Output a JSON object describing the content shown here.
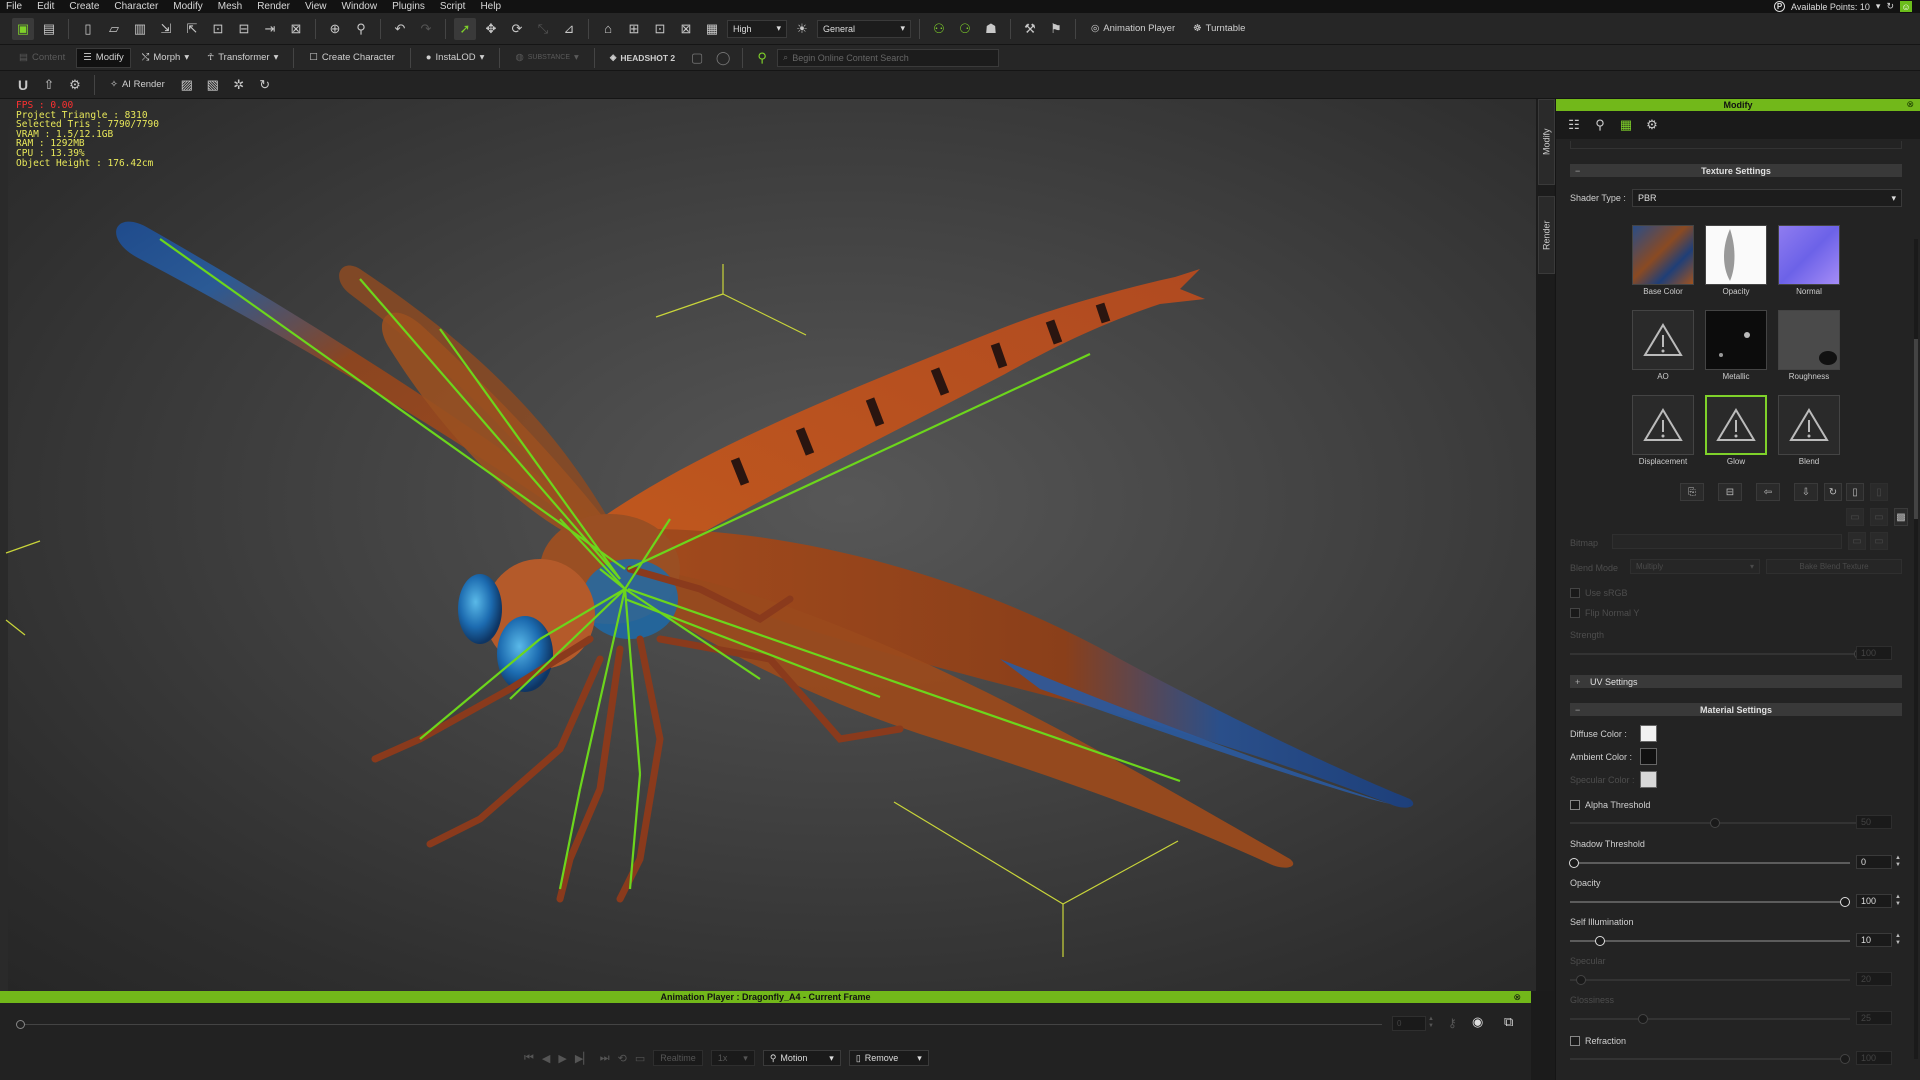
{
  "menu": [
    "File",
    "Edit",
    "Create",
    "Character",
    "Modify",
    "Mesh",
    "Render",
    "View",
    "Window",
    "Plugins",
    "Script",
    "Help"
  ],
  "available_points": "Available Points: 10",
  "toolbar1": {
    "quality": "High",
    "preset": "General",
    "animation_player": "Animation Player",
    "turntable": "Turntable"
  },
  "toolbar2": {
    "content": "Content",
    "modify": "Modify",
    "morph": "Morph",
    "transformer": "Transformer",
    "create_character": "Create Character",
    "instalod": "InstaLOD",
    "substance": "SUBSTANCE",
    "headshot": "HEADSHOT 2",
    "search_placeholder": "Begin Online Content Search"
  },
  "toolbar3": {
    "ai_render": "AI Render"
  },
  "stats": {
    "fps": "FPS : 0.00",
    "project_triangle": "Project Triangle : 8310",
    "selected_tris": "Selected Tris : 7790/7790",
    "vram": "VRAM : 1.5/12.1GB",
    "ram": "RAM : 1292MB",
    "cpu": "CPU : 13.39%",
    "object_height": "Object Height : 176.42cm"
  },
  "side_tabs": {
    "modify": "Modify",
    "render": "Render"
  },
  "panel": {
    "title": "Modify",
    "texture_section": "Texture Settings",
    "shader_type_label": "Shader Type :",
    "shader_type_value": "PBR",
    "textures": [
      "Base Color",
      "Opacity",
      "Normal",
      "AO",
      "Metallic",
      "Roughness",
      "Displacement",
      "Glow",
      "Blend"
    ],
    "bitmap_label": "Bitmap",
    "blend_mode_label": "Blend Mode",
    "blend_mode_value": "Multiply",
    "bake_blend_texture": "Bake Blend Texture",
    "use_srgb": "Use sRGB",
    "flip_normal_y": "Flip Normal Y",
    "strength_label": "Strength",
    "strength_value": "100",
    "uv_section": "UV Settings",
    "material_section": "Material Settings",
    "diffuse_label": "Diffuse Color :",
    "ambient_label": "Ambient Color :",
    "specular_color_label": "Specular Color :",
    "diffuse_color": "#f2f2f2",
    "ambient_color": "#111111",
    "specular_color": "#d8d8d8",
    "alpha_threshold": "Alpha Threshold",
    "alpha_value": "50",
    "shadow_threshold": "Shadow Threshold",
    "shadow_value": "0",
    "opacity_label": "Opacity",
    "opacity_value": "100",
    "self_illumination": "Self Illumination",
    "self_illumination_value": "10",
    "specular_label": "Specular",
    "specular_value": "20",
    "glossiness_label": "Glossiness",
    "glossiness_value": "25",
    "refraction_label": "Refraction",
    "refraction_value": "100"
  },
  "animation": {
    "title": "Animation Player : Dragonfly_A4 - Current Frame",
    "frame": "0",
    "realtime": "Realtime",
    "speed": "1x",
    "motion": "Motion",
    "remove": "Remove"
  }
}
